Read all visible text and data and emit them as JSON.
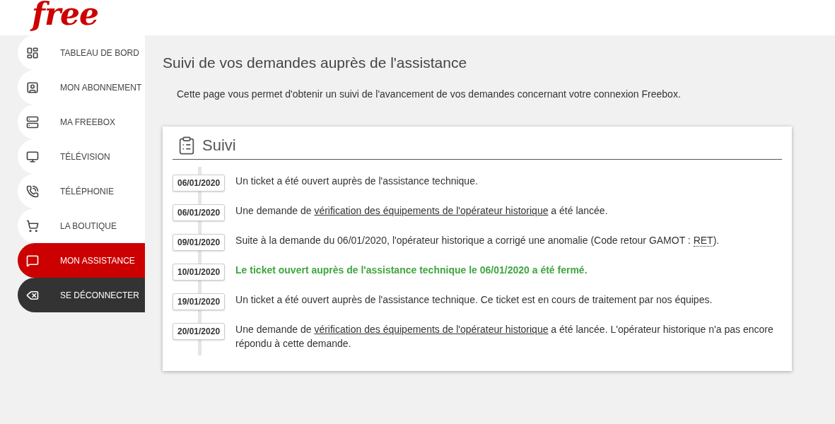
{
  "logo": "free",
  "sidebar": {
    "items": [
      {
        "label": "TABLEAU DE BORD",
        "kind": "nav",
        "selected": false
      },
      {
        "label": "MON ABONNEMENT",
        "kind": "nav",
        "selected": false
      },
      {
        "label": "MA FREEBOX",
        "kind": "nav",
        "selected": false
      },
      {
        "label": "TÉLÉVISION",
        "kind": "nav",
        "selected": false
      },
      {
        "label": "TÉLÉPHONIE",
        "kind": "nav",
        "selected": false
      },
      {
        "label": "LA BOUTIQUE",
        "kind": "nav",
        "selected": false
      },
      {
        "label": "MON ASSISTANCE",
        "kind": "nav",
        "selected": true
      },
      {
        "label": "SE DÉCONNECTER",
        "kind": "logout",
        "selected": false
      }
    ]
  },
  "page": {
    "title": "Suivi de vos demandes auprès de l'assistance",
    "intro": "Cette page vous permet d'obtenir un suivi de l'avancement de vos demandes concernant votre connexion Freebox.",
    "card": {
      "title": "Suivi",
      "events": [
        {
          "date": "06/01/2020",
          "kind": "normal",
          "parts": [
            {
              "kind": "text",
              "text": "Un ticket a été ouvert auprès de l'assistance technique."
            }
          ]
        },
        {
          "date": "06/01/2020",
          "kind": "normal",
          "parts": [
            {
              "kind": "text",
              "text": "Une demande de "
            },
            {
              "kind": "link",
              "text": "vérification des équipements de l'opérateur historique"
            },
            {
              "kind": "text",
              "text": " a été lancée."
            }
          ]
        },
        {
          "date": "09/01/2020",
          "kind": "normal",
          "parts": [
            {
              "kind": "text",
              "text": "Suite à la demande du 06/01/2020, l'opérateur historique a corrigé une anomalie (Code retour GAMOT : "
            },
            {
              "kind": "abbr",
              "text": "RET"
            },
            {
              "kind": "text",
              "text": ")."
            }
          ]
        },
        {
          "date": "10/01/2020",
          "kind": "closed",
          "parts": [
            {
              "kind": "text",
              "text": "Le ticket ouvert auprès de l'assistance technique le 06/01/2020 a été fermé."
            }
          ]
        },
        {
          "date": "19/01/2020",
          "kind": "normal",
          "parts": [
            {
              "kind": "text",
              "text": "Un ticket a été ouvert auprès de l'assistance technique. Ce ticket est en cours de traitement par nos équipes."
            }
          ]
        },
        {
          "date": "20/01/2020",
          "kind": "normal",
          "parts": [
            {
              "kind": "text",
              "text": "Une demande de "
            },
            {
              "kind": "link",
              "text": "vérification des équipements de l'opérateur historique"
            },
            {
              "kind": "text",
              "text": " a été lancée. L'opérateur historique n'a pas encore répondu à cette demande."
            }
          ]
        }
      ]
    }
  }
}
